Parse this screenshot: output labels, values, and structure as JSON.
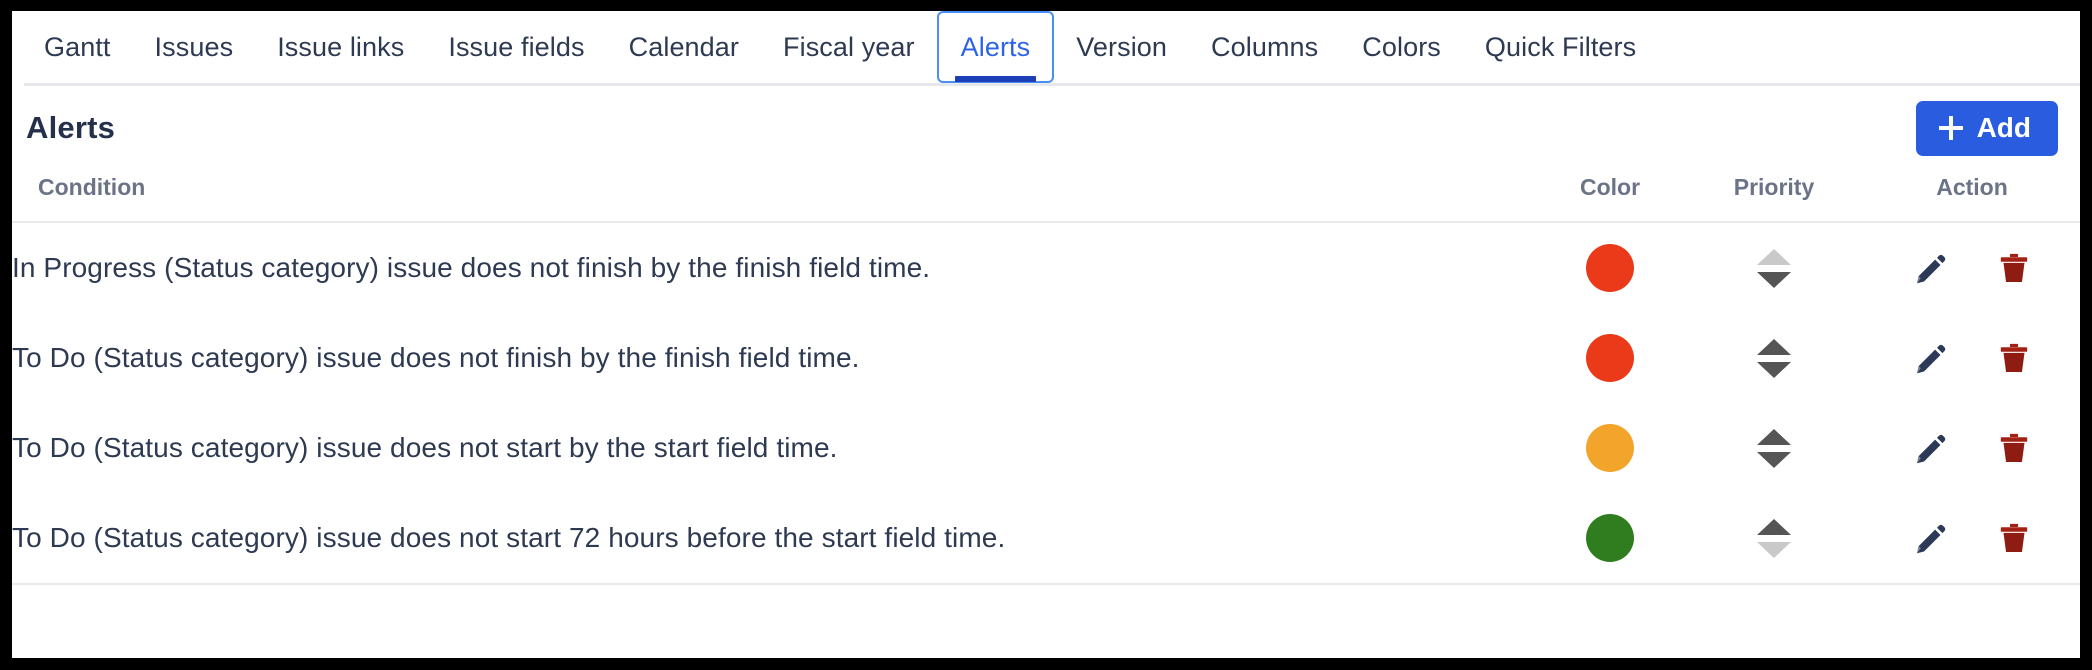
{
  "tabs": [
    {
      "label": "Gantt",
      "active": false
    },
    {
      "label": "Issues",
      "active": false
    },
    {
      "label": "Issue links",
      "active": false
    },
    {
      "label": "Issue fields",
      "active": false
    },
    {
      "label": "Calendar",
      "active": false
    },
    {
      "label": "Fiscal year",
      "active": false
    },
    {
      "label": "Alerts",
      "active": true
    },
    {
      "label": "Version",
      "active": false
    },
    {
      "label": "Columns",
      "active": false
    },
    {
      "label": "Colors",
      "active": false
    },
    {
      "label": "Quick Filters",
      "active": false
    }
  ],
  "header": {
    "title": "Alerts",
    "add_label": "Add",
    "add_icon": "plus-icon",
    "add_button_color": "#2a5ce0"
  },
  "table": {
    "columns": {
      "condition": "Condition",
      "color": "Color",
      "priority": "Priority",
      "action": "Action"
    },
    "rows": [
      {
        "condition": "In Progress (Status category) issue does not finish by the finish field time.",
        "color": "#ea3a19",
        "color_name": "red",
        "move_up_enabled": false,
        "move_down_enabled": true,
        "edit_icon": "pencil-icon",
        "delete_icon": "trash-icon"
      },
      {
        "condition": "To Do (Status category) issue does not finish by the finish field time.",
        "color": "#ea3a19",
        "color_name": "red",
        "move_up_enabled": true,
        "move_down_enabled": true,
        "edit_icon": "pencil-icon",
        "delete_icon": "trash-icon"
      },
      {
        "condition": "To Do (Status category) issue does not start by the start field time.",
        "color": "#f2a42b",
        "color_name": "orange",
        "move_up_enabled": true,
        "move_down_enabled": true,
        "edit_icon": "pencil-icon",
        "delete_icon": "trash-icon"
      },
      {
        "condition": "To Do (Status category) issue does not start 72 hours before the start field time.",
        "color": "#2f7d1f",
        "color_name": "green",
        "move_up_enabled": true,
        "move_down_enabled": false,
        "edit_icon": "pencil-icon",
        "delete_icon": "trash-icon"
      }
    ]
  },
  "icon_colors": {
    "pencil": "#2c3a57",
    "trash": "#a32015",
    "arrow_enabled": "#555555",
    "arrow_disabled": "#c9c9c9"
  }
}
